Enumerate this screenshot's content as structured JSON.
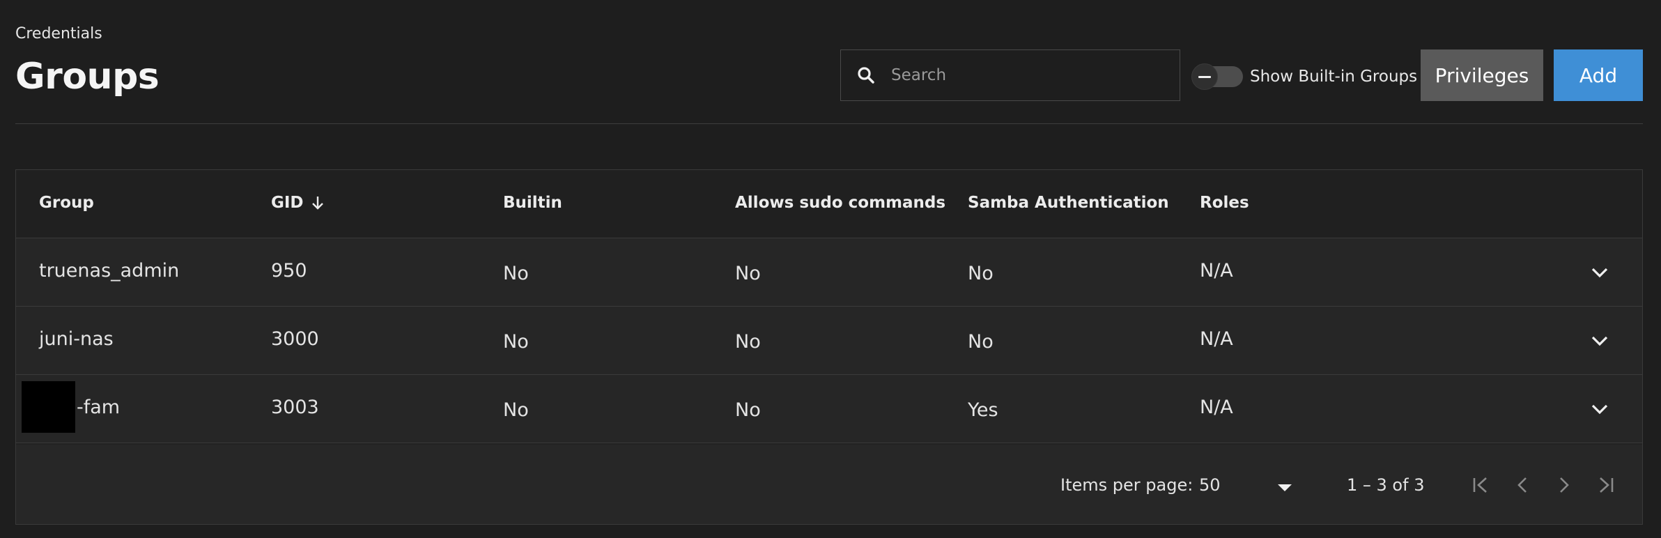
{
  "header": {
    "breadcrumb": "Credentials",
    "title": "Groups",
    "search_placeholder": "Search",
    "search_value": "",
    "toggle_label": "Show Built-in Groups",
    "toggle_on": false,
    "privileges_label": "Privileges",
    "add_label": "Add"
  },
  "table": {
    "columns": [
      "Group",
      "GID",
      "Builtin",
      "Allows sudo commands",
      "Samba Authentication",
      "Roles"
    ],
    "sort": {
      "column": "GID",
      "direction": "descending-arrow",
      "icon": "arrow-down-icon"
    },
    "rows": [
      {
        "group": "truenas_admin",
        "gid": "950",
        "builtin": "No",
        "sudo": "No",
        "samba": "No",
        "roles": "N/A"
      },
      {
        "group": "juni-nas",
        "gid": "3000",
        "builtin": "No",
        "sudo": "No",
        "samba": "No",
        "roles": "N/A"
      },
      {
        "group": "-fam",
        "gid": "3003",
        "builtin": "No",
        "sudo": "No",
        "samba": "Yes",
        "roles": "N/A",
        "redacted_prefix": true
      }
    ]
  },
  "paginator": {
    "items_per_page_label": "Items per page:",
    "items_per_page_value": "50",
    "range_label": "1 – 3 of 3"
  },
  "colors": {
    "background": "#1e1e1e",
    "accent": "#3f8fd6",
    "secondary_button": "#5a5a5a"
  }
}
